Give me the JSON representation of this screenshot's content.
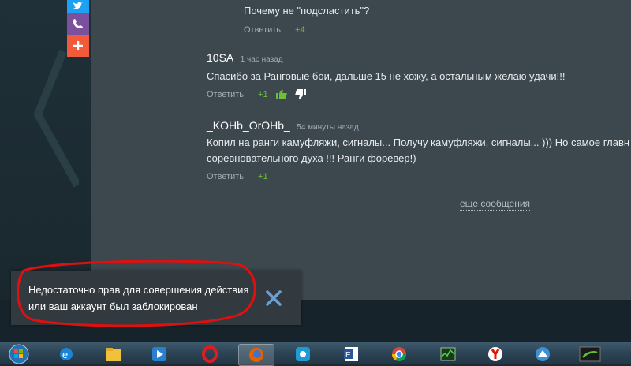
{
  "comments": [
    {
      "text": "Почему не \"подсластить\"?",
      "reply_label": "Ответить",
      "score": "+4"
    },
    {
      "author": "10SA",
      "time": "1 час назад",
      "text": "Спасибо за Ранговые бои, дальше 15 не хожу, а остальным желаю удачи!!!",
      "reply_label": "Ответить",
      "score": "+1"
    },
    {
      "author": "_KOHb_OrOHb_",
      "time": "54 минуты назад",
      "text_line1": "Копил на ранги камуфляжи, сигналы... Получу камуфляжи, сигналы... ))) Но самое главн",
      "text_line2": "соревновательного духа !!! Ранги форевер!)",
      "reply_label": "Ответить",
      "score": "+1"
    }
  ],
  "more_messages_label": "еще сообщения",
  "notification": {
    "line1": "Недостаточно прав для совершения действия",
    "line2": "или ваш аккаунт был заблокирован"
  },
  "share_icons": [
    "twitter-icon",
    "viber-icon",
    "plus-icon"
  ],
  "taskbar_icons": [
    "windows-start-icon",
    "internet-explorer-icon",
    "file-explorer-icon",
    "media-player-icon",
    "opera-icon",
    "firefox-icon",
    "app-icon",
    "word-icon",
    "chrome-icon",
    "task-manager-icon",
    "yandex-icon",
    "app-icon-2",
    "xbox-icon"
  ],
  "colors": {
    "accent_green": "#6bbf3a",
    "close_blue": "#6a9fd4",
    "annotation_red": "#e01010"
  }
}
